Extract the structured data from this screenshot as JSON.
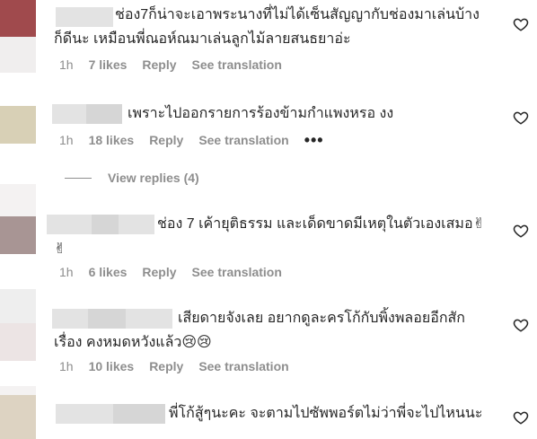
{
  "comments": [
    {
      "text_line1": "ช่อง7ก็น่าจะเอาพระนางที่ไม่ได้เซ็นสัญญากับช่องมาเล่นบ้าง",
      "text_line2": "ก็ดีนะ เหมือนพี่ณอห์ณมาเล่นลูกไม้ลายสนธยาอ่ะ",
      "time": "1h",
      "likes": "7 likes",
      "reply": "Reply",
      "translate": "See translation"
    },
    {
      "text_line1": "เพราะไปออกรายการร้องข้ามกำแพงหรอ งง",
      "time": "1h",
      "likes": "18 likes",
      "reply": "Reply",
      "translate": "See translation",
      "more": "•••"
    },
    {
      "text_line1": "ช่อง 7 เค้ายุติธรรม และเด็ดขาดมีเหตุในตัวเองเสมอ✌",
      "text_line2": "✌",
      "time": "1h",
      "likes": "6 likes",
      "reply": "Reply",
      "translate": "See translation"
    },
    {
      "text_line1": "เสียดายจังเลย อยากดูละครโก้กับพิ้งพลอยอีกสัก",
      "text_line2": "เรื่อง คงหมดหวังแล้ว😢😢",
      "time": "1h",
      "likes": "10 likes",
      "reply": "Reply",
      "translate": "See translation"
    },
    {
      "text_line1": "พี่โก้สู้ๆนะคะ จะตามไปซัพพอร์ตไม่ว่าพี่จะไปไหนนะ"
    }
  ],
  "view_replies": "View replies (4)",
  "colors": {
    "text": "#262626",
    "secondary": "#8e8e8e",
    "avatar1": "#a04a4d",
    "avatar2": "#d8d0b6",
    "avatar3": "#a89594",
    "avatar4": "#ece4e4",
    "avatar5": "#ddd3c2"
  },
  "icons": {
    "like": "heart-outline-icon"
  }
}
